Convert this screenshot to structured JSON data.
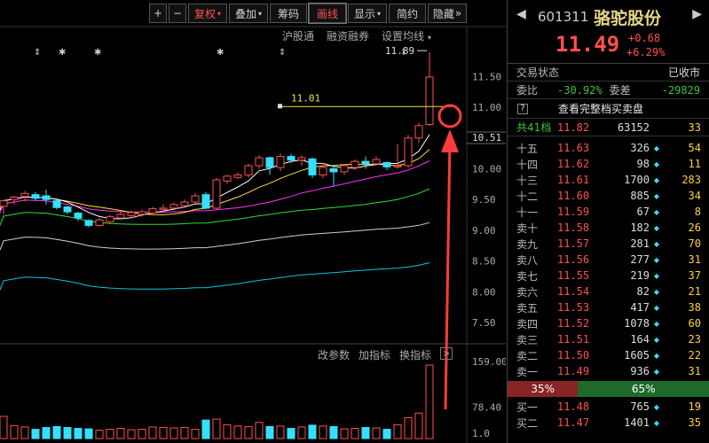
{
  "toolbar": {
    "plus": "+",
    "minus": "−",
    "fuquan": "复权",
    "diejia": "叠加",
    "chouma": "筹码",
    "huaxian": "画线",
    "xianshi": "显示",
    "jianyue": "简约",
    "yincang": "隐藏",
    "expand": "»"
  },
  "subbar": {
    "hgt": "沪股通",
    "rzrq": "融资融券",
    "ma": "设置均线"
  },
  "annotations": {
    "high_label": "11.89",
    "line_label": "11.01"
  },
  "price_axis": [
    "11.50",
    "11.00",
    "10.51",
    "10.00",
    "9.50",
    "9.00",
    "8.50",
    "8.00",
    "7.50"
  ],
  "vol_axis": [
    "159.00",
    "78.40",
    "1.0"
  ],
  "indicator_bar": {
    "params": "改参数",
    "add": "加指标",
    "switch": "换指标",
    "box": ">"
  },
  "stock": {
    "code": "601311",
    "name": "骆驼股份",
    "price": "11.49",
    "change": "+0.68",
    "change_pct": "+6.29%"
  },
  "status": {
    "label": "交易状态",
    "value": "已收市"
  },
  "ratio": {
    "label1": "委比",
    "value1": "-30.92%",
    "label2": "委差",
    "value2": "-29829"
  },
  "full_book": {
    "q": "?",
    "text": "查看完整档买卖盘"
  },
  "all_levels": {
    "label": "共41档",
    "price": "11.82",
    "vol": "63152",
    "cnt": "33"
  },
  "asks": [
    {
      "label": "十五",
      "price": "11.63",
      "vol": "326",
      "cnt": "54"
    },
    {
      "label": "十四",
      "price": "11.62",
      "vol": "98",
      "cnt": "11"
    },
    {
      "label": "十三",
      "price": "11.61",
      "vol": "1700",
      "cnt": "283"
    },
    {
      "label": "十二",
      "price": "11.60",
      "vol": "885",
      "cnt": "34"
    },
    {
      "label": "十一",
      "price": "11.59",
      "vol": "67",
      "cnt": "8"
    },
    {
      "label": "卖十",
      "price": "11.58",
      "vol": "182",
      "cnt": "26"
    },
    {
      "label": "卖九",
      "price": "11.57",
      "vol": "281",
      "cnt": "70"
    },
    {
      "label": "卖八",
      "price": "11.56",
      "vol": "277",
      "cnt": "31"
    },
    {
      "label": "卖七",
      "price": "11.55",
      "vol": "219",
      "cnt": "37"
    },
    {
      "label": "卖六",
      "price": "11.54",
      "vol": "82",
      "cnt": "21"
    },
    {
      "label": "卖五",
      "price": "11.53",
      "vol": "417",
      "cnt": "38"
    },
    {
      "label": "卖四",
      "price": "11.52",
      "vol": "1078",
      "cnt": "60"
    },
    {
      "label": "卖三",
      "price": "11.51",
      "vol": "164",
      "cnt": "23"
    },
    {
      "label": "卖二",
      "price": "11.50",
      "vol": "1605",
      "cnt": "22"
    },
    {
      "label": "卖一",
      "price": "11.49",
      "vol": "936",
      "cnt": "31"
    }
  ],
  "pct_bar": {
    "sell": "35%",
    "buy": "65%",
    "sell_fraction": 0.35
  },
  "bids": [
    {
      "label": "买一",
      "price": "11.48",
      "vol": "765",
      "cnt": "19"
    },
    {
      "label": "买二",
      "price": "11.47",
      "vol": "1401",
      "cnt": "35"
    }
  ],
  "colors": {
    "up": "#ff5050",
    "down": "#33e0ff",
    "ma5": "#ffffff",
    "ma10": "#ffe033",
    "ma20": "#ff33ff",
    "ma30": "#33dd33",
    "ma60": "#cfcfcf",
    "ma120": "#00c8e0"
  },
  "chart_data": {
    "type": "candlestick",
    "ylim": [
      7.2,
      11.95
    ],
    "candles": [
      {
        "o": 9.39,
        "h": 9.5,
        "l": 9.26,
        "c": 9.48,
        "v": 48
      },
      {
        "o": 9.5,
        "h": 9.56,
        "l": 9.42,
        "c": 9.54,
        "v": 28
      },
      {
        "o": 9.55,
        "h": 9.64,
        "l": 9.47,
        "c": 9.6,
        "v": 25
      },
      {
        "o": 9.58,
        "h": 9.62,
        "l": 9.48,
        "c": 9.52,
        "v": 20
      },
      {
        "o": 9.56,
        "h": 9.66,
        "l": 9.42,
        "c": 9.5,
        "v": 24
      },
      {
        "o": 9.48,
        "h": 9.5,
        "l": 9.34,
        "c": 9.37,
        "v": 26
      },
      {
        "o": 9.38,
        "h": 9.4,
        "l": 9.26,
        "c": 9.3,
        "v": 24
      },
      {
        "o": 9.28,
        "h": 9.3,
        "l": 9.15,
        "c": 9.2,
        "v": 22
      },
      {
        "o": 9.16,
        "h": 9.18,
        "l": 9.05,
        "c": 9.08,
        "v": 21
      },
      {
        "o": 9.08,
        "h": 9.2,
        "l": 9.06,
        "c": 9.17,
        "v": 18
      },
      {
        "o": 9.14,
        "h": 9.25,
        "l": 9.1,
        "c": 9.22,
        "v": 20
      },
      {
        "o": 9.2,
        "h": 9.3,
        "l": 9.18,
        "c": 9.26,
        "v": 22
      },
      {
        "o": 9.24,
        "h": 9.32,
        "l": 9.2,
        "c": 9.29,
        "v": 19
      },
      {
        "o": 9.26,
        "h": 9.34,
        "l": 9.22,
        "c": 9.3,
        "v": 20
      },
      {
        "o": 9.28,
        "h": 9.38,
        "l": 9.24,
        "c": 9.35,
        "v": 25
      },
      {
        "o": 9.34,
        "h": 9.42,
        "l": 9.3,
        "c": 9.36,
        "v": 24
      },
      {
        "o": 9.36,
        "h": 9.45,
        "l": 9.33,
        "c": 9.42,
        "v": 23
      },
      {
        "o": 9.4,
        "h": 9.5,
        "l": 9.38,
        "c": 9.46,
        "v": 24
      },
      {
        "o": 9.46,
        "h": 9.6,
        "l": 9.44,
        "c": 9.56,
        "v": 20
      },
      {
        "o": 9.58,
        "h": 9.62,
        "l": 9.34,
        "c": 9.36,
        "v": 40
      },
      {
        "o": 9.36,
        "h": 9.85,
        "l": 9.34,
        "c": 9.82,
        "v": 42
      },
      {
        "o": 9.8,
        "h": 9.9,
        "l": 9.76,
        "c": 9.88,
        "v": 30
      },
      {
        "o": 9.86,
        "h": 9.94,
        "l": 9.83,
        "c": 9.9,
        "v": 27
      },
      {
        "o": 9.9,
        "h": 10.08,
        "l": 9.86,
        "c": 10.05,
        "v": 26
      },
      {
        "o": 10.05,
        "h": 10.22,
        "l": 10.0,
        "c": 10.18,
        "v": 35
      },
      {
        "o": 10.18,
        "h": 10.2,
        "l": 9.9,
        "c": 10.02,
        "v": 26
      },
      {
        "o": 10.02,
        "h": 10.25,
        "l": 9.96,
        "c": 10.2,
        "v": 27
      },
      {
        "o": 10.2,
        "h": 10.24,
        "l": 10.1,
        "c": 10.14,
        "v": 22
      },
      {
        "o": 10.14,
        "h": 10.22,
        "l": 10.05,
        "c": 10.18,
        "v": 25
      },
      {
        "o": 10.16,
        "h": 10.18,
        "l": 9.85,
        "c": 9.9,
        "v": 29
      },
      {
        "o": 9.9,
        "h": 10.1,
        "l": 9.85,
        "c": 10.02,
        "v": 27
      },
      {
        "o": 10.0,
        "h": 10.05,
        "l": 9.72,
        "c": 9.95,
        "v": 26
      },
      {
        "o": 9.95,
        "h": 10.08,
        "l": 9.9,
        "c": 10.05,
        "v": 21
      },
      {
        "o": 10.02,
        "h": 10.15,
        "l": 9.98,
        "c": 10.12,
        "v": 22
      },
      {
        "o": 10.12,
        "h": 10.2,
        "l": 10.0,
        "c": 10.08,
        "v": 24
      },
      {
        "o": 10.08,
        "h": 10.2,
        "l": 10.05,
        "c": 10.15,
        "v": 23
      },
      {
        "o": 10.1,
        "h": 10.12,
        "l": 9.98,
        "c": 10.03,
        "v": 20
      },
      {
        "o": 10.03,
        "h": 10.4,
        "l": 10.0,
        "c": 10.05,
        "v": 30
      },
      {
        "o": 10.05,
        "h": 10.55,
        "l": 10.02,
        "c": 10.5,
        "v": 45
      },
      {
        "o": 10.5,
        "h": 10.75,
        "l": 10.42,
        "c": 10.7,
        "v": 55
      },
      {
        "o": 10.72,
        "h": 11.89,
        "l": 10.7,
        "c": 11.49,
        "v": 159
      }
    ]
  }
}
